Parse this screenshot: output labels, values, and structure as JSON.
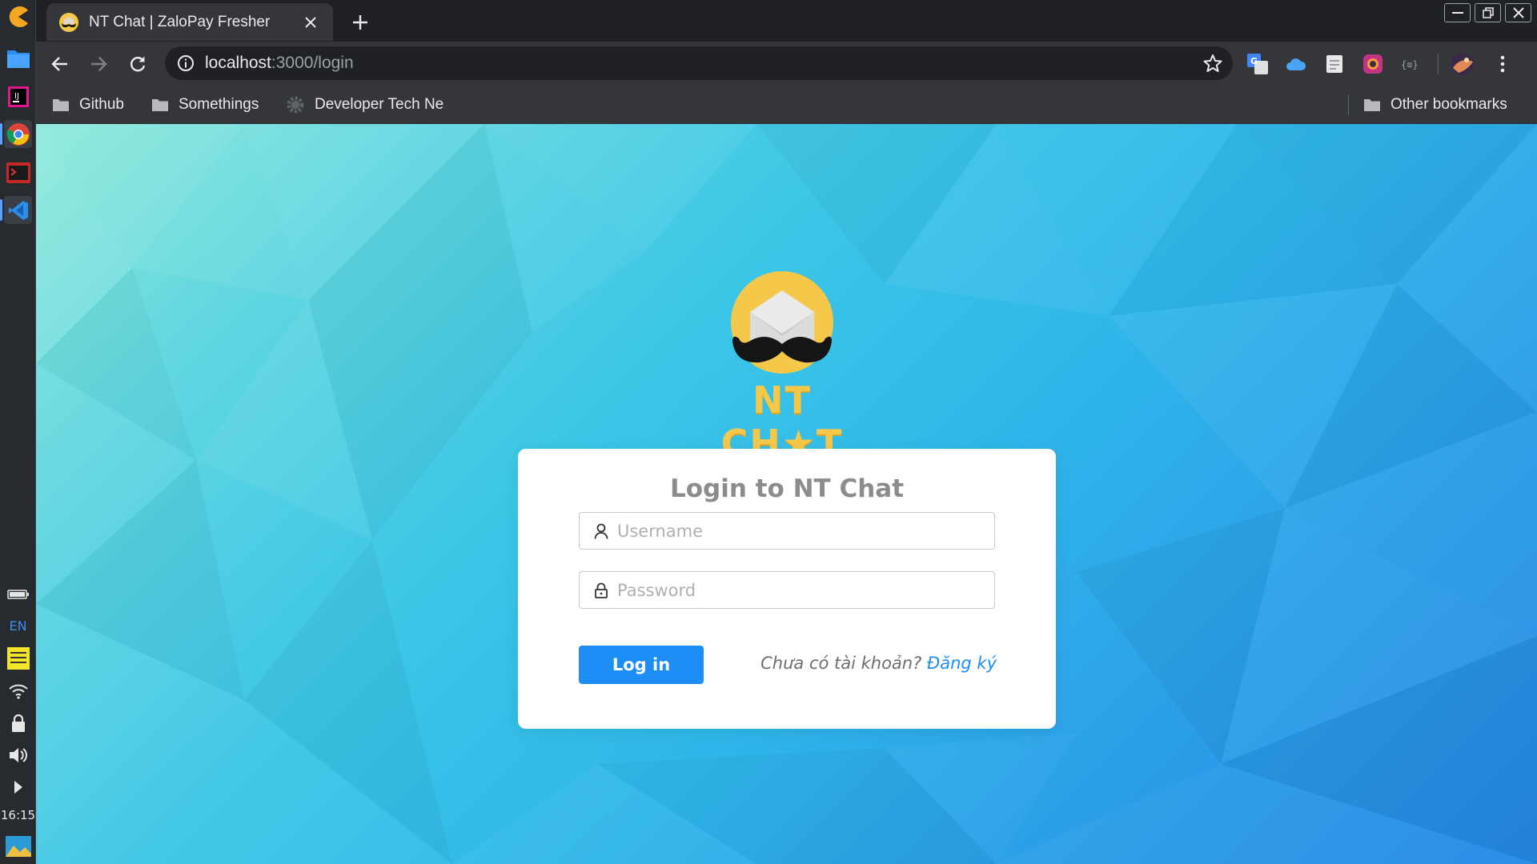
{
  "browser": {
    "tab_title": "NT Chat | ZaloPay Fresher",
    "url_host": "localhost",
    "url_rest": ":3000/login",
    "bookmarks": [
      {
        "label": "Github"
      },
      {
        "label": "Somethings"
      },
      {
        "label": "Developer Tech Ne"
      }
    ],
    "other_bookmarks_label": "Other bookmarks"
  },
  "os": {
    "keyboard_lang": "EN",
    "clock": "16:15"
  },
  "page": {
    "logo_text": "NT CH★T",
    "form_title": "Login to NT Chat",
    "username_placeholder": "Username",
    "password_placeholder": "Password",
    "login_button": "Log in",
    "register_prompt": "Chưa có tài khoản?",
    "register_link": "Đăng ký"
  },
  "colors": {
    "primary": "#1d8ef5",
    "logo_yellow": "#f6c84a",
    "background_start": "#88e8d8",
    "background_end": "#2489e4"
  }
}
